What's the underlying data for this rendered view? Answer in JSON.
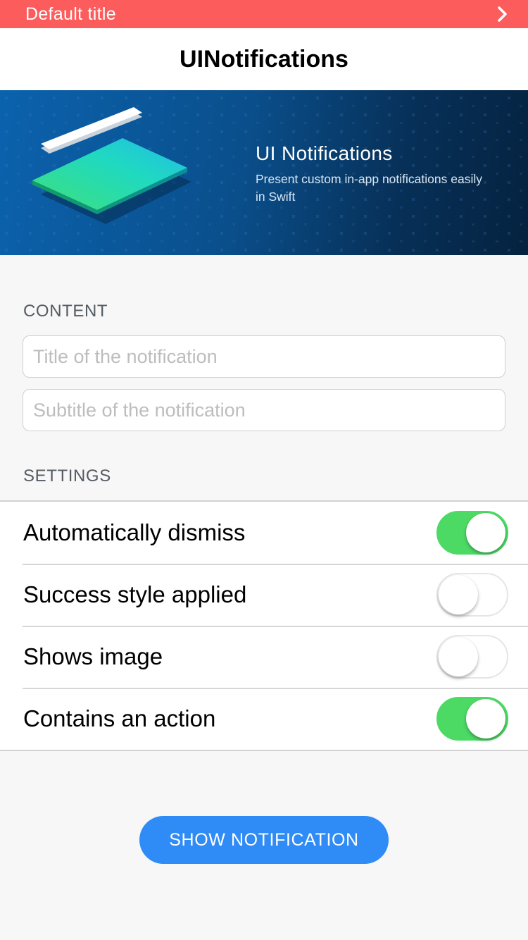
{
  "notification": {
    "title": "Default title",
    "color": "#fc5c5c",
    "icon": "chevron-right-icon"
  },
  "nav": {
    "title": "UINotifications"
  },
  "hero": {
    "heading": "UI Notifications",
    "subtitle": "Present custom in-app notifications easily in Swift",
    "illustration": "stacked-cards-illustration"
  },
  "content_section": {
    "header": "CONTENT",
    "title_placeholder": "Title of the notification",
    "subtitle_placeholder": "Subtitle of the notification",
    "title_value": "",
    "subtitle_value": ""
  },
  "settings_section": {
    "header": "SETTINGS",
    "items": [
      {
        "label": "Automatically dismiss",
        "on": true
      },
      {
        "label": "Success style applied",
        "on": false
      },
      {
        "label": "Shows image",
        "on": false
      },
      {
        "label": "Contains an action",
        "on": true
      }
    ],
    "toggle_on_color": "#4cd964"
  },
  "action": {
    "label": "SHOW NOTIFICATION",
    "color": "#2f8bf6"
  }
}
